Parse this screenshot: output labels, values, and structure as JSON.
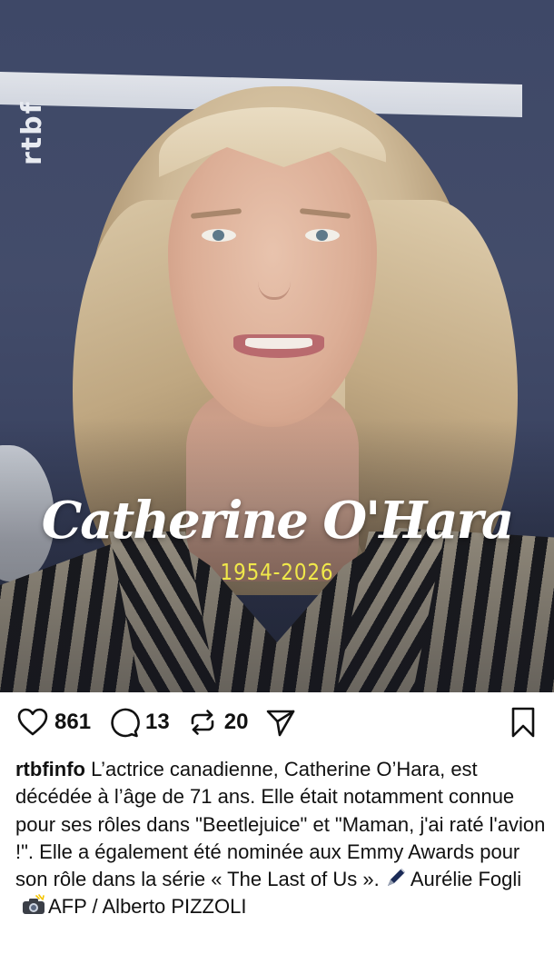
{
  "photo": {
    "watermark": "rtbf",
    "overlay_name": "Catherine O'Hara",
    "overlay_years": "1954-2026",
    "years_color": "#f0e84a"
  },
  "actions": {
    "likes": "861",
    "comments": "13",
    "reposts": "20",
    "icons": [
      "heart-icon",
      "comment-icon",
      "repost-icon",
      "share-icon",
      "bookmark-icon"
    ]
  },
  "caption": {
    "username": "rtbfinfo",
    "text": "L’actrice canadienne, Catherine O’Hara, est décédée à l’âge de 71 ans. Elle était notamment connue pour ses rôles dans \"Beetlejuice\" et \"Maman, j'ai raté l'avion !\". Elle a également été nominée aux Emmy Awards pour son rôle dans la série « The Last of Us ».",
    "author": "Aurélie Fogli",
    "photo_credit": "AFP /  Alberto PIZZOLI"
  }
}
